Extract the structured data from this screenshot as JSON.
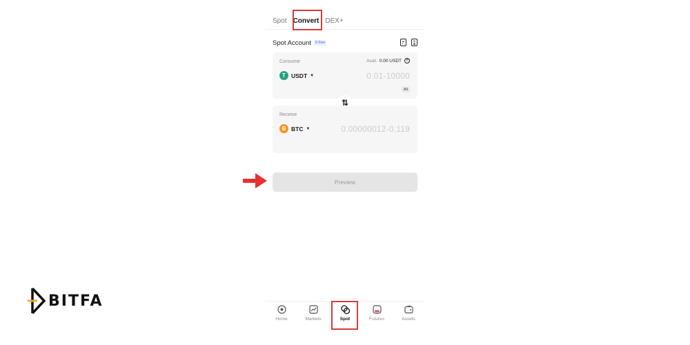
{
  "tabs": [
    {
      "label": "Spot",
      "active": false
    },
    {
      "label": "Convert",
      "active": true
    },
    {
      "label": "DEX+",
      "active": false
    }
  ],
  "account": {
    "title": "Spot Account",
    "fee_badge": "0 Fee",
    "icons": [
      "history-icon",
      "order-list-icon"
    ]
  },
  "consume": {
    "label": "Consume",
    "avail_label": "Avail.",
    "avail_value": "0.00 USDT",
    "coin": "USDT",
    "coin_icon": "tether-icon",
    "coin_color": "#26a17b",
    "amount_placeholder": "0.01-10000",
    "all_label": "All"
  },
  "swap_icon": "swap-vertical-icon",
  "receive": {
    "label": "Receive",
    "coin": "BTC",
    "coin_icon": "bitcoin-icon",
    "coin_color": "#f7931a",
    "amount_placeholder": "0.00000012-0.119"
  },
  "preview_button": "Preview",
  "nav": [
    {
      "label": "Home",
      "icon": "home-icon",
      "active": false
    },
    {
      "label": "Markets",
      "icon": "markets-icon",
      "active": false
    },
    {
      "label": "Spot",
      "icon": "spot-icon",
      "active": true
    },
    {
      "label": "Futures",
      "icon": "futures-icon",
      "active": false
    },
    {
      "label": "Assets",
      "icon": "assets-icon",
      "active": false
    }
  ],
  "logo_text": "BITFA",
  "colors": {
    "highlight": "#d63a3a",
    "arrow": "#e33232",
    "logo_accent": "#f0a92a"
  }
}
